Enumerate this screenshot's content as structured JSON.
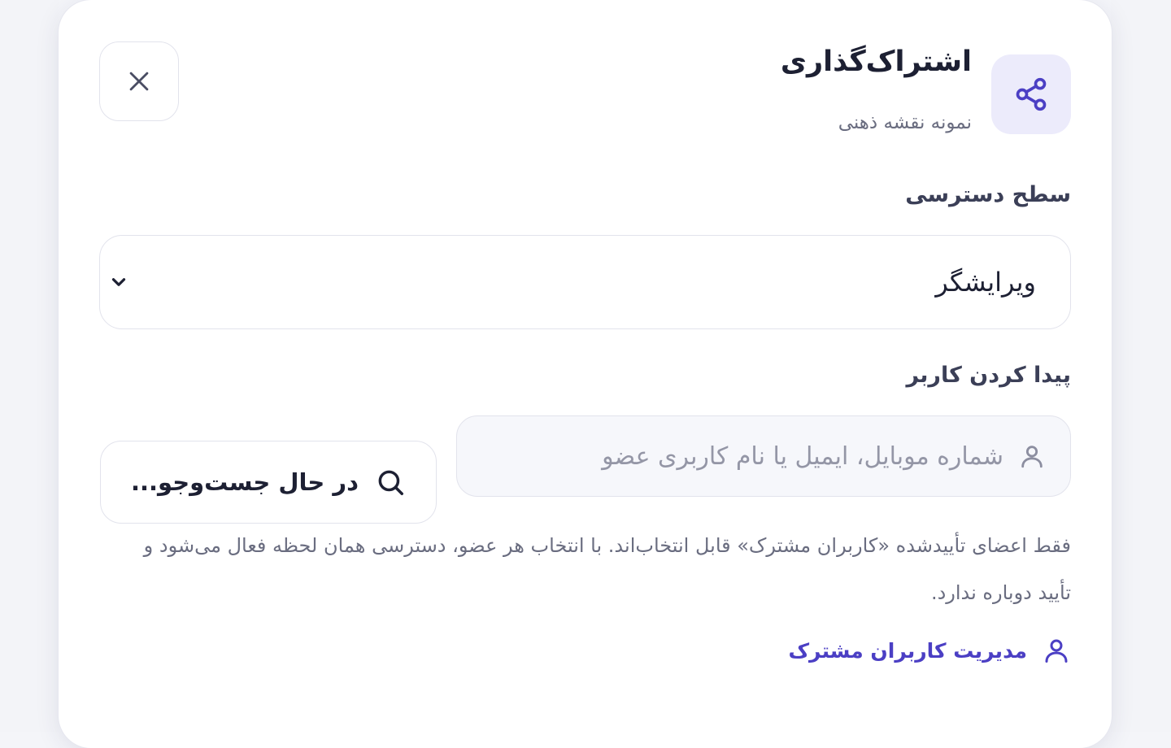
{
  "dialog": {
    "title": "اشتراک‌گذاری",
    "subtitle": "نمونه نقشه ذهنی"
  },
  "access": {
    "label": "سطح دسترسی",
    "selected": "ویرایشگر"
  },
  "find_user": {
    "label": "پیدا کردن کاربر",
    "placeholder": "شماره موبایل، ایمیل یا نام کاربری عضو",
    "searching_label": "در حال جست‌وجو..."
  },
  "help_text": "فقط اعضای تأییدشده «کاربران مشترک» قابل انتخاب‌اند. با انتخاب هر عضو، دسترسی همان لحظه فعال می‌شود و تأیید دوباره ندارد.",
  "manage_link": "مدیریت کاربران مشترک",
  "icons": {
    "share": "share-icon",
    "close": "close-icon",
    "chevron": "chevron-down-icon",
    "user": "user-icon",
    "search": "search-icon"
  },
  "colors": {
    "accent": "#4b3fc4",
    "tile_bg": "#ecebfb"
  }
}
